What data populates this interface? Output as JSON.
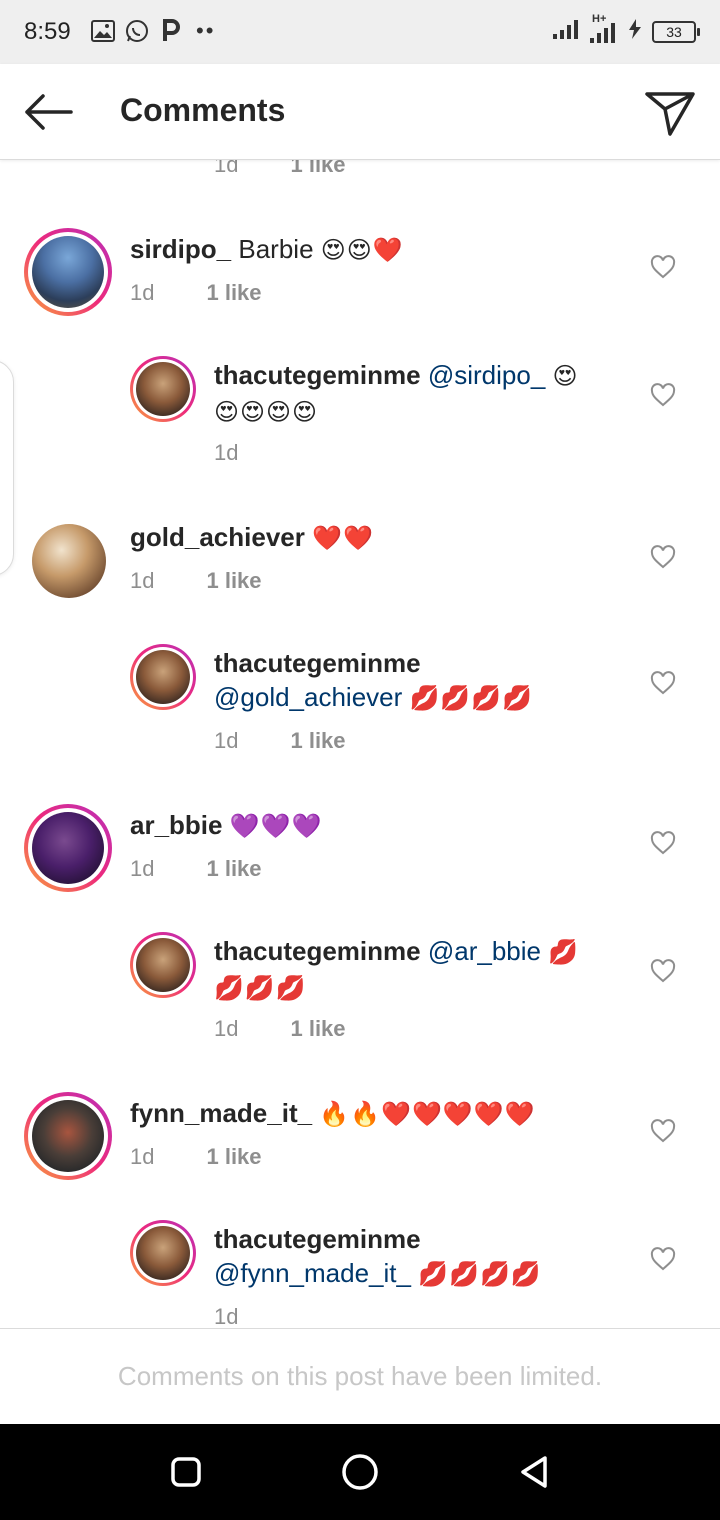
{
  "status_bar": {
    "time": "8:59",
    "left_icons": [
      "image-icon",
      "whatsapp-icon",
      "p-icon"
    ],
    "dots": "••",
    "network": "H+",
    "battery": "33"
  },
  "header": {
    "title": "Comments",
    "back_icon": "arrow-left-icon",
    "send_icon": "send-icon"
  },
  "partial": {
    "time": "1d",
    "likes": "1 like"
  },
  "comments": [
    {
      "username": "sirdipo_",
      "text": "Barbie",
      "emoji": "😍😍❤️",
      "time": "1d",
      "likes": "1 like"
    },
    {
      "username": "thacutegeminme",
      "mention": "@sirdipo_",
      "emoji_inline": "😍",
      "emoji_line2": "😍😍😍😍",
      "time": "1d",
      "likes": ""
    },
    {
      "username": "gold_achiever",
      "emoji": "❤️❤️",
      "time": "1d",
      "likes": "1 like"
    },
    {
      "username": "thacutegeminme",
      "mention": "@gold_achiever",
      "emoji": "💋💋💋💋",
      "time": "1d",
      "likes": "1 like"
    },
    {
      "username": "ar_bbie",
      "emoji": "💜💜💜",
      "time": "1d",
      "likes": "1 like"
    },
    {
      "username": "thacutegeminme",
      "mention": "@ar_bbie",
      "emoji_inline": "💋",
      "emoji_line2": "💋💋💋",
      "time": "1d",
      "likes": "1 like"
    },
    {
      "username": "fynn_made_it_",
      "emoji": "🔥🔥❤️❤️❤️❤️❤️",
      "time": "1d",
      "likes": "1 like"
    },
    {
      "username": "thacutegeminme",
      "mention": "@fynn_made_it_",
      "emoji": "💋💋💋💋",
      "time": "1d",
      "likes": ""
    }
  ],
  "footer": {
    "text": "Comments on this post have been limited."
  },
  "colors": {
    "mention": "#00376b",
    "meta": "#8e8e8e",
    "divider": "#dbdbdb"
  }
}
